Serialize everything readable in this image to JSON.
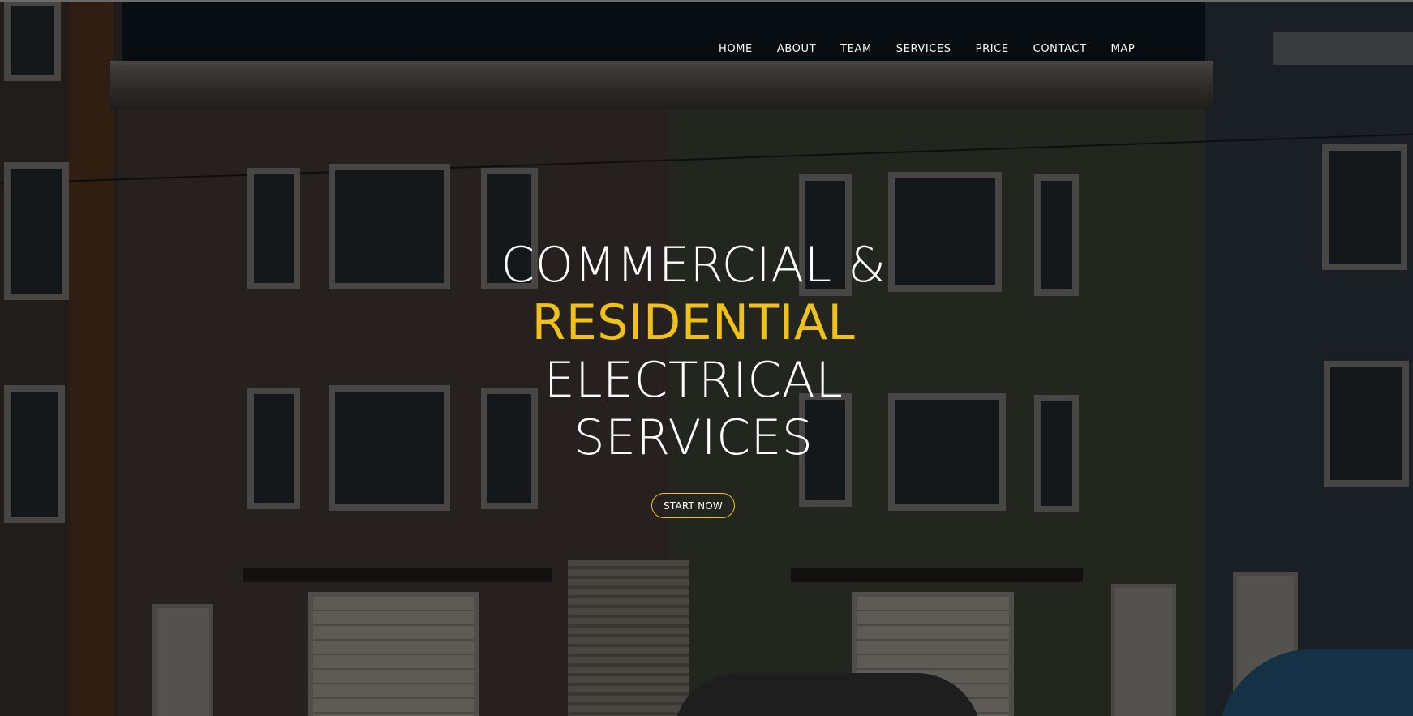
{
  "nav": {
    "items": [
      {
        "label": "HOME"
      },
      {
        "label": "ABOUT"
      },
      {
        "label": "TEAM"
      },
      {
        "label": "SERVICES"
      },
      {
        "label": "PRICE"
      },
      {
        "label": "CONTACT"
      },
      {
        "label": "MAP"
      }
    ]
  },
  "hero": {
    "line1": "COMMERCIAL &",
    "line2": "RESIDENTIAL",
    "line3": "ELECTRICAL",
    "line4": "SERVICES",
    "cta_label": "START NOW"
  },
  "colors": {
    "accent": "#f1c11b",
    "text": "#ffffff",
    "overlay": "rgba(0,0,0,0.48)"
  }
}
